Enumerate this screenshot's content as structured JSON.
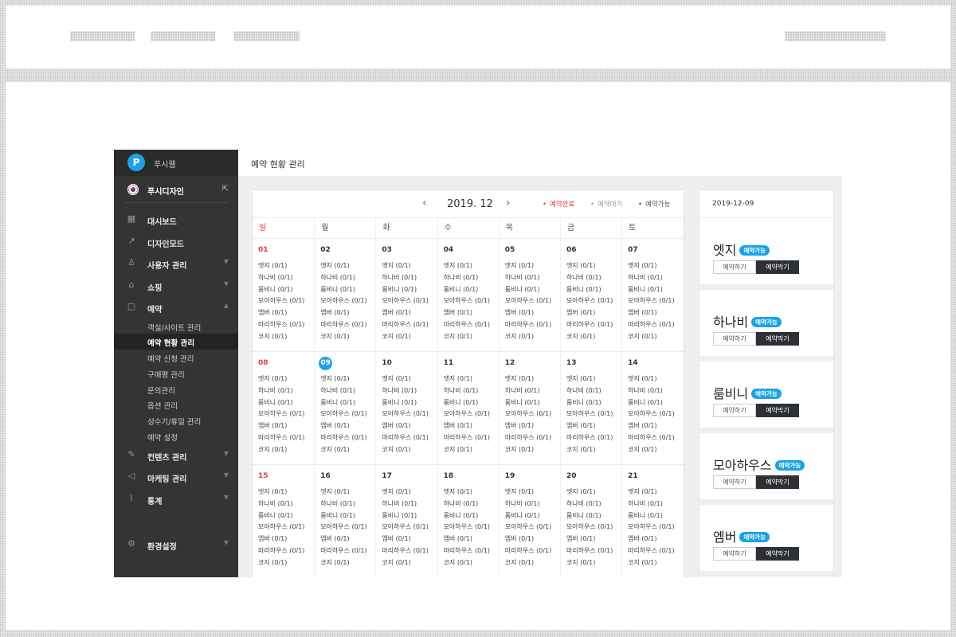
{
  "app": {
    "brand": "푸시웹",
    "site_name": "푸시디자인",
    "page_title": "예약 현황 관리"
  },
  "sidebar": {
    "items": [
      {
        "label": "대시보드",
        "icon": "grid-icon",
        "chevron": false
      },
      {
        "label": "디자인모드",
        "icon": "wand-icon",
        "chevron": false
      },
      {
        "label": "사용자 관리",
        "icon": "user-icon",
        "chevron": true
      },
      {
        "label": "쇼핑",
        "icon": "bag-icon",
        "chevron": true
      },
      {
        "label": "예약",
        "icon": "calendar-icon",
        "chevron": true,
        "expanded": true
      }
    ],
    "subitems": [
      "객실/사이트 관리",
      "예약 현황 관리",
      "예약 신청 관리",
      "구매평 관리",
      "문의관리",
      "옵션 관리",
      "성수기/휴일 관리",
      "예약 설정"
    ],
    "active_subitem": "예약 현황 관리",
    "items2": [
      {
        "label": "컨텐츠 관리",
        "icon": "edit-icon"
      },
      {
        "label": "마케팅 관리",
        "icon": "megaphone-icon"
      },
      {
        "label": "통계",
        "icon": "chart-icon"
      }
    ],
    "settings": "환경설정"
  },
  "calendar": {
    "month": "2019. 12",
    "legend": [
      {
        "label": "예약완료",
        "color": "#e04242"
      },
      {
        "label": "예약대기",
        "color": "#999999"
      },
      {
        "label": "예약가능",
        "color": "#555555"
      }
    ],
    "weekdays": [
      "일",
      "월",
      "화",
      "수",
      "목",
      "금",
      "토"
    ],
    "rooms": [
      "엣지 (0/1)",
      "하나비 (0/1)",
      "룸비니 (0/1)",
      "모아하우스 (0/1)",
      "엠버 (0/1)",
      "마리하우스 (0/1)",
      "코지 (0/1)"
    ],
    "weeks": [
      [
        "01",
        "02",
        "03",
        "04",
        "05",
        "06",
        "07"
      ],
      [
        "08",
        "09",
        "10",
        "11",
        "12",
        "13",
        "14"
      ],
      [
        "15",
        "16",
        "17",
        "18",
        "19",
        "20",
        "21"
      ]
    ],
    "today": "09",
    "accent": "#1aa3e8"
  },
  "panel": {
    "date": "2019-12-09",
    "badge": "예약가능",
    "btn_reserve": "예약하기",
    "btn_block": "예약막기",
    "rooms": [
      "엣지",
      "하나비",
      "룸비니",
      "모아하우스",
      "엠버"
    ]
  }
}
